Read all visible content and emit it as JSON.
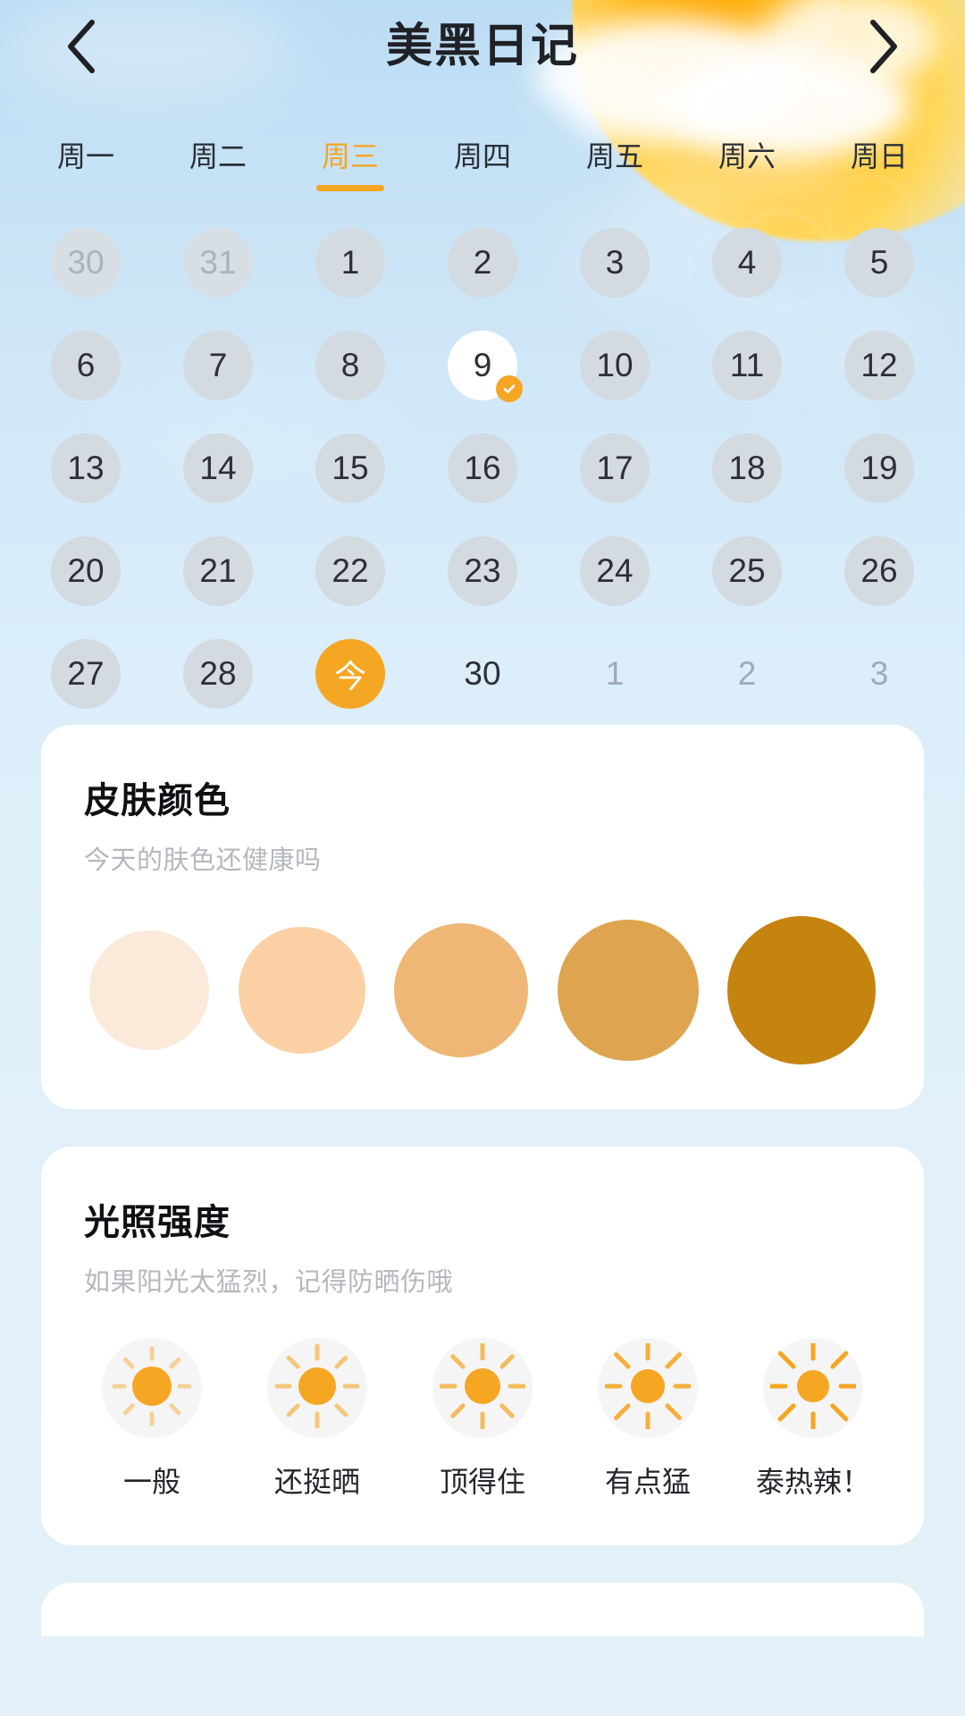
{
  "header": {
    "title": "美黑日记",
    "back_icon": "chevron-left-icon",
    "forward_icon": "chevron-right-icon"
  },
  "calendar": {
    "weekdays": [
      {
        "label": "周一",
        "active": false
      },
      {
        "label": "周二",
        "active": false
      },
      {
        "label": "周三",
        "active": true
      },
      {
        "label": "周四",
        "active": false
      },
      {
        "label": "周五",
        "active": false
      },
      {
        "label": "周六",
        "active": false
      },
      {
        "label": "周日",
        "active": false
      }
    ],
    "days": [
      {
        "label": "30",
        "state": "muted"
      },
      {
        "label": "31",
        "state": "muted"
      },
      {
        "label": "1",
        "state": "normal"
      },
      {
        "label": "2",
        "state": "normal"
      },
      {
        "label": "3",
        "state": "normal"
      },
      {
        "label": "4",
        "state": "normal"
      },
      {
        "label": "5",
        "state": "normal"
      },
      {
        "label": "6",
        "state": "normal"
      },
      {
        "label": "7",
        "state": "normal"
      },
      {
        "label": "8",
        "state": "normal"
      },
      {
        "label": "9",
        "state": "selected",
        "badge": "check-icon"
      },
      {
        "label": "10",
        "state": "normal"
      },
      {
        "label": "11",
        "state": "normal"
      },
      {
        "label": "12",
        "state": "normal"
      },
      {
        "label": "13",
        "state": "normal"
      },
      {
        "label": "14",
        "state": "normal"
      },
      {
        "label": "15",
        "state": "normal"
      },
      {
        "label": "16",
        "state": "normal"
      },
      {
        "label": "17",
        "state": "normal"
      },
      {
        "label": "18",
        "state": "normal"
      },
      {
        "label": "19",
        "state": "normal"
      },
      {
        "label": "20",
        "state": "normal"
      },
      {
        "label": "21",
        "state": "normal"
      },
      {
        "label": "22",
        "state": "normal"
      },
      {
        "label": "23",
        "state": "normal"
      },
      {
        "label": "24",
        "state": "normal"
      },
      {
        "label": "25",
        "state": "normal"
      },
      {
        "label": "26",
        "state": "normal"
      },
      {
        "label": "27",
        "state": "normal"
      },
      {
        "label": "28",
        "state": "normal"
      },
      {
        "label": "今",
        "state": "today"
      },
      {
        "label": "30",
        "state": "plain"
      },
      {
        "label": "1",
        "state": "plain-muted"
      },
      {
        "label": "2",
        "state": "plain-muted"
      },
      {
        "label": "3",
        "state": "plain-muted"
      }
    ]
  },
  "skin_card": {
    "title": "皮肤颜色",
    "subtitle": "今天的肤色还健康吗",
    "swatches": [
      {
        "color": "#fbeada",
        "size": 134
      },
      {
        "color": "#fad0a4",
        "size": 142
      },
      {
        "color": "#eeb776",
        "size": 150
      },
      {
        "color": "#dfa44f",
        "size": 158
      },
      {
        "color": "#c5830f",
        "size": 166
      }
    ]
  },
  "light_card": {
    "title": "光照强度",
    "subtitle": "如果阳光太猛烈，记得防晒伤哦",
    "levels": [
      {
        "label": "一般",
        "icon": "sun-icon",
        "core": 44,
        "ray_len": 11,
        "ray_gap": 9,
        "ray_opacity": 0.45
      },
      {
        "label": "还挺晒",
        "icon": "sun-icon",
        "core": 42,
        "ray_len": 14,
        "ray_gap": 10,
        "ray_opacity": 0.58
      },
      {
        "label": "顶得住",
        "icon": "sun-icon",
        "core": 40,
        "ray_len": 16,
        "ray_gap": 11,
        "ray_opacity": 0.72
      },
      {
        "label": "有点猛",
        "icon": "sun-icon",
        "core": 38,
        "ray_len": 19,
        "ray_gap": 12,
        "ray_opacity": 0.88
      },
      {
        "label": "泰热辣！",
        "icon": "sun-icon",
        "core": 36,
        "ray_len": 21,
        "ray_gap": 13,
        "ray_opacity": 1.0
      }
    ]
  },
  "colors": {
    "accent": "#f5a623",
    "sky_top": "#bcdcf4",
    "sky_bottom": "#e4f1f9",
    "day_bg": "#d3dae0",
    "text": "#2b2f36",
    "muted_text": "#b4b8bd"
  }
}
